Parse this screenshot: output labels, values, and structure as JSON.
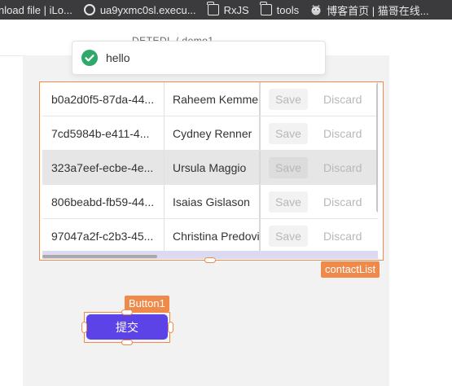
{
  "bookmarks": [
    {
      "label": "nload file | iLo...",
      "icon": "globe-icon"
    },
    {
      "label": "ua9yxmc0sl.execu...",
      "icon": "globe-icon"
    },
    {
      "label": "RxJS",
      "icon": "folder-icon"
    },
    {
      "label": "tools",
      "icon": "folder-icon"
    },
    {
      "label": "博客首页 | 猫哥在线...",
      "icon": "owl-icon"
    }
  ],
  "breadcrumb": "DETEDL / demo1",
  "toast": {
    "message": "hello",
    "icon": "check-circle-icon",
    "color": "#2fa96a"
  },
  "table": {
    "component_label": "contactList",
    "rows": [
      {
        "id": "b0a2d0f5-87da-44...",
        "name": "Raheem Kemme",
        "save": "Save",
        "discard": "Discard"
      },
      {
        "id": "7cd5984b-e411-4...",
        "name": "Cydney Renner",
        "save": "Save",
        "discard": "Discard"
      },
      {
        "id": "323a7eef-ecbe-4e...",
        "name": "Ursula Maggio",
        "save": "Save",
        "discard": "Discard"
      },
      {
        "id": "806beabd-fb59-44...",
        "name": "Isaias Gislason",
        "save": "Save",
        "discard": "Discard"
      },
      {
        "id": "97047a2f-c2b3-45...",
        "name": "Christina Predovi",
        "save": "Save",
        "discard": "Discard"
      }
    ],
    "highlighted_row": 2
  },
  "button": {
    "component_label": "Button1",
    "label": "提交",
    "color": "#5b43e8"
  },
  "colors": {
    "selection": "#f08a4b",
    "bookmarks_bg": "#3b3b3e"
  }
}
